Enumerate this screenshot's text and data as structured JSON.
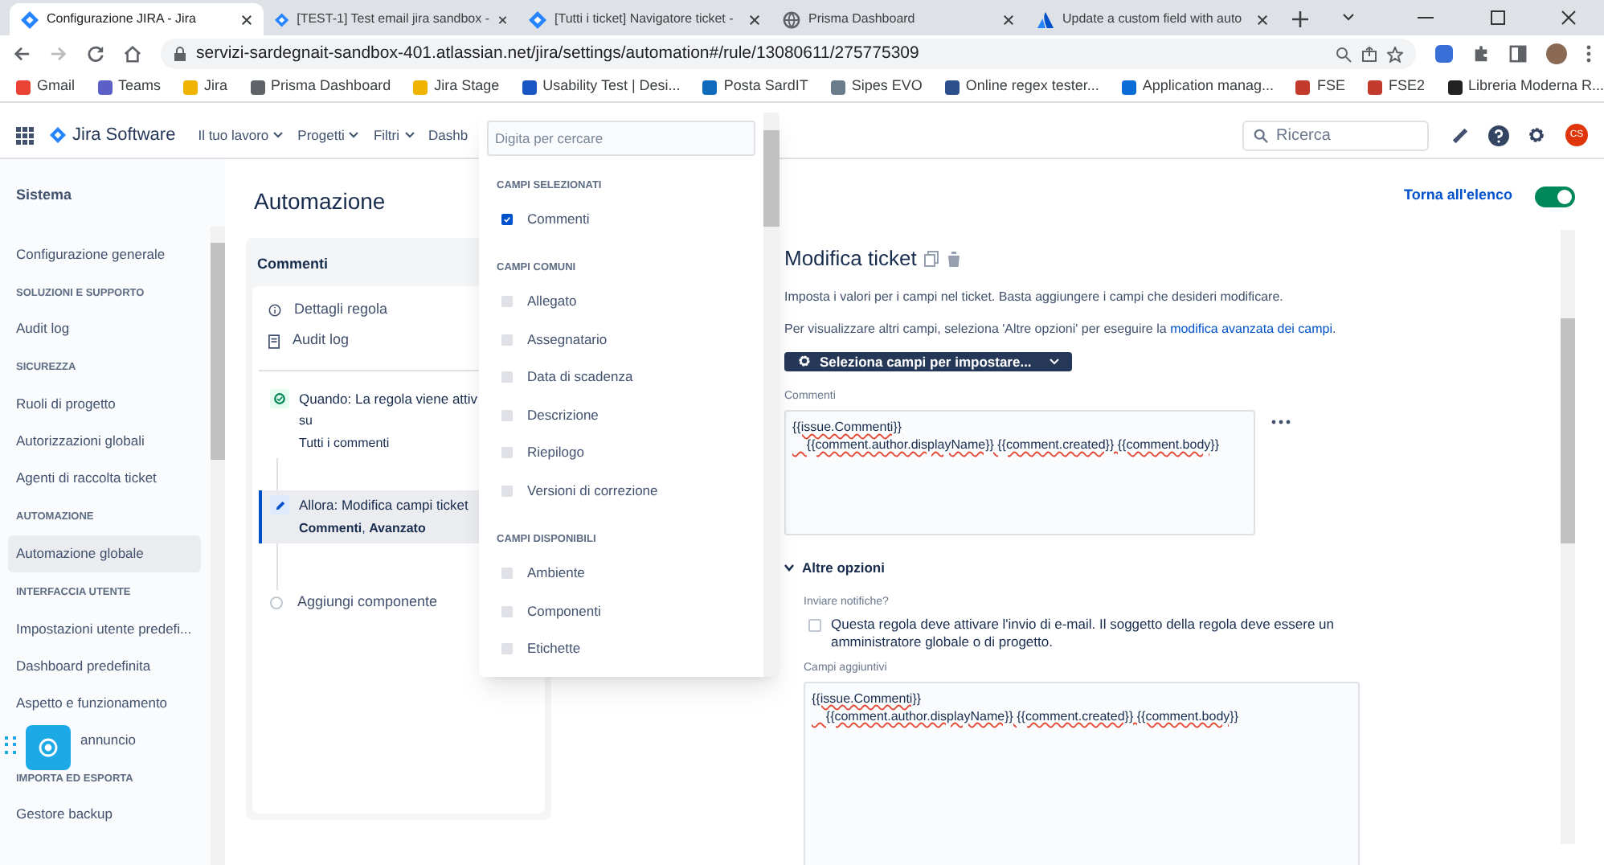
{
  "browser": {
    "tabs": [
      {
        "title": "Configurazione JIRA - Jira",
        "selected": true,
        "kind": "jira"
      },
      {
        "title": "[TEST-1] Test email jira sandbox -",
        "selected": false,
        "kind": "jira"
      },
      {
        "title": "[Tutti i ticket] Navigatore ticket -",
        "selected": false,
        "kind": "jira"
      },
      {
        "title": "Prisma Dashboard",
        "selected": false,
        "kind": "globe"
      },
      {
        "title": "Update a custom field with auto",
        "selected": false,
        "kind": "atlassian"
      }
    ],
    "url": "servizi-sardegnait-sandbox-401.atlassian.net/jira/settings/automation#/rule/13080611/275775309",
    "bookmarks": [
      {
        "label": "Gmail",
        "color": "#ea4335"
      },
      {
        "label": "Teams",
        "color": "#5b5fc7"
      },
      {
        "label": "Jira",
        "color": "#f0b400"
      },
      {
        "label": "Prisma Dashboard",
        "color": "#5f6368"
      },
      {
        "label": "Jira Stage",
        "color": "#f0b400"
      },
      {
        "label": "Usability Test | Desi...",
        "color": "#1a55c4"
      },
      {
        "label": "Posta SardIT",
        "color": "#0f6cbd"
      },
      {
        "label": "Sipes EVO",
        "color": "#6b7c8c"
      },
      {
        "label": "Online regex tester...",
        "color": "#2c4f8c"
      },
      {
        "label": "Application manag...",
        "color": "#0a6cd6"
      },
      {
        "label": "FSE",
        "color": "#c23a2b"
      },
      {
        "label": "FSE2",
        "color": "#c23a2b"
      },
      {
        "label": "Libreria Moderna R...",
        "color": "#222222"
      }
    ]
  },
  "header": {
    "product": "Jira Software",
    "nav": [
      "Il tuo lavoro",
      "Progetti",
      "Filtri",
      "Dashb"
    ],
    "search_placeholder": "Ricerca",
    "avatar": "CS"
  },
  "sidebar": {
    "items": [
      {
        "kind": "title",
        "label": "Sistema"
      },
      {
        "kind": "item",
        "label": "Configurazione generale",
        "selected": false
      },
      {
        "kind": "heading",
        "label": "SOLUZIONI E SUPPORTO"
      },
      {
        "kind": "item",
        "label": "Audit log",
        "selected": false
      },
      {
        "kind": "heading",
        "label": "SICUREZZA"
      },
      {
        "kind": "item",
        "label": "Ruoli di progetto",
        "selected": false
      },
      {
        "kind": "item",
        "label": "Autorizzazioni globali",
        "selected": false
      },
      {
        "kind": "item",
        "label": "Agenti di raccolta ticket",
        "selected": false
      },
      {
        "kind": "heading",
        "label": "AUTOMAZIONE"
      },
      {
        "kind": "item",
        "label": "Automazione globale",
        "selected": true
      },
      {
        "kind": "heading",
        "label": "INTERFACCIA UTENTE"
      },
      {
        "kind": "item",
        "label": "Impostazioni utente predefi...",
        "selected": false
      },
      {
        "kind": "item",
        "label": "Dashboard predefinita",
        "selected": false
      },
      {
        "kind": "item",
        "label": "Aspetto e funzionamento",
        "selected": false
      },
      {
        "kind": "item",
        "label": "annuncio",
        "selected": false
      },
      {
        "kind": "heading",
        "label": "IMPORTA ED ESPORTA"
      },
      {
        "kind": "item",
        "label": "Gestore backup",
        "selected": false
      }
    ]
  },
  "page_title": "Automazione",
  "rule": {
    "name": "Commenti",
    "links": [
      {
        "label": "Dettagli regola",
        "kind": "info"
      },
      {
        "label": "Audit log",
        "kind": "log"
      }
    ],
    "steps": [
      {
        "kind": "trigger",
        "title": "Quando: La regola viene attiv",
        "lines": [
          "su",
          "Tutti i commenti"
        ],
        "selected": false
      },
      {
        "kind": "action",
        "title": "Allora: Modifica campi ticket",
        "lines": [
          "**Commenti**, **Avanzato**"
        ],
        "selected": true
      }
    ],
    "add": "Aggiungi componente"
  },
  "editor": {
    "back": "Torna all'elenco",
    "enabled": true,
    "title": "Modifica ticket",
    "description": "Imposta i valori per i campi nel ticket. Basta aggiungere i campi che desideri modificare.",
    "hint": "Per visualizzare altri campi, seleziona 'Altre opzioni' per eseguire la ",
    "hint_link": "modifica avanzata dei campi",
    "hint_end": ".",
    "select_button": "Seleziona campi per impostare...",
    "field_label": "Commenti",
    "field_value": "{{issue.Commenti}}\n    {{comment.author.displayName}} {{comment.created}} {{comment.body}}",
    "more_options": {
      "label": "Altre opzioni",
      "expanded": true,
      "notify_label": "Inviare notifiche?",
      "notify_text": "Questa regola deve attivare l'invio di e-mail. Il soggetto della regola deve essere un amministratore globale o di progetto.",
      "notify_checked": false,
      "extra_label": "Campi aggiuntivi",
      "extra_value": "{{issue.Commenti}}\n    {{comment.author.displayName}} {{comment.created}} {{comment.body}}"
    }
  },
  "dropdown": {
    "placeholder": "Digita per cercare",
    "groups": [
      {
        "heading": "CAMPI SELEZIONATI",
        "items": [
          {
            "label": "Commenti",
            "checked": true
          }
        ]
      },
      {
        "heading": "CAMPI COMUNI",
        "items": [
          {
            "label": "Allegato",
            "checked": false
          },
          {
            "label": "Assegnatario",
            "checked": false
          },
          {
            "label": "Data di scadenza",
            "checked": false
          },
          {
            "label": "Descrizione",
            "checked": false
          },
          {
            "label": "Riepilogo",
            "checked": false
          },
          {
            "label": "Versioni di correzione",
            "checked": false
          }
        ]
      },
      {
        "heading": "CAMPI DISPONIBILI",
        "items": [
          {
            "label": "Ambiente",
            "checked": false
          },
          {
            "label": "Componenti",
            "checked": false
          },
          {
            "label": "Etichette",
            "checked": false
          }
        ]
      }
    ]
  }
}
